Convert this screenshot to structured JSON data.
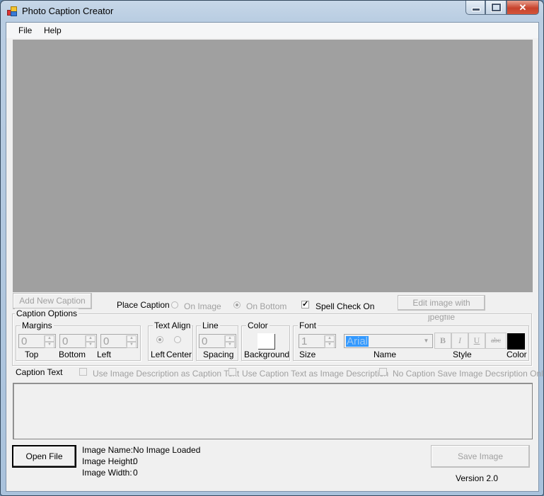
{
  "window": {
    "title": "Photo Caption Creator",
    "controls": {
      "minimize": "minimize-icon",
      "maximize": "maximize-icon",
      "close": "close-icon"
    }
  },
  "menu": {
    "items": [
      "File",
      "Help"
    ]
  },
  "toolbar": {
    "add_caption": "Add New Caption",
    "place_caption_label": "Place Caption",
    "place_options": [
      {
        "label": "On Image",
        "selected": false
      },
      {
        "label": "On Bottom",
        "selected": true
      }
    ],
    "spell_check": {
      "label": "Spell Check On",
      "checked": true
    },
    "edit_button": "Edit image with jpegfile"
  },
  "caption_options": {
    "title": "Caption Options",
    "margins": {
      "title": "Margins",
      "fields": [
        {
          "label": "Top",
          "value": "0"
        },
        {
          "label": "Bottom",
          "value": "0"
        },
        {
          "label": "Left",
          "value": "0"
        }
      ]
    },
    "text_align": {
      "title": "Text Align",
      "options": [
        {
          "label": "Left",
          "selected": true
        },
        {
          "label": "Center",
          "selected": false
        }
      ]
    },
    "line": {
      "title": "Line",
      "value": "0",
      "label": "Spacing"
    },
    "color": {
      "title": "Color",
      "label": "Background",
      "value": "#ffffff"
    },
    "font": {
      "title": "Font",
      "size": {
        "value": "1",
        "label": "Size"
      },
      "name": {
        "value": "Arial",
        "label": "Name"
      },
      "style": {
        "label": "Style",
        "buttons": [
          "B",
          "I",
          "U",
          "abc"
        ]
      },
      "color": {
        "label": "Color",
        "value": "#000000"
      }
    }
  },
  "caption_text": {
    "label": "Caption Text",
    "checkboxes": [
      {
        "label": "Use Image Description as Caption Text",
        "checked": false
      },
      {
        "label": "Use Caption Text as Image Description",
        "checked": false
      },
      {
        "label": "No Caption Save Image Decsription Only.",
        "checked": false
      }
    ],
    "value": ""
  },
  "footer": {
    "open_file": "Open File",
    "info": [
      {
        "label": "Image Name:",
        "value": "No Image Loaded"
      },
      {
        "label": "Image Height:",
        "value": "0"
      },
      {
        "label": "Image Width:",
        "value": "0"
      }
    ],
    "save_image": "Save Image",
    "version": "Version 2.0"
  }
}
